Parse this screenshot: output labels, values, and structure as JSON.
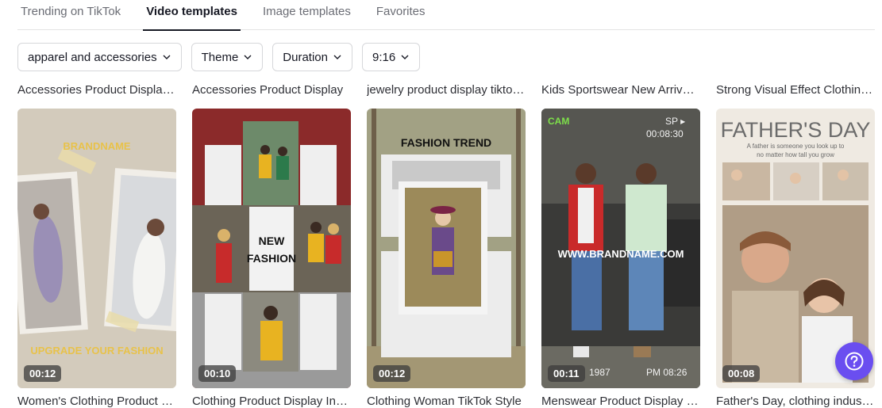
{
  "tabs": [
    {
      "label": "Trending on TikTok",
      "active": false
    },
    {
      "label": "Video templates",
      "active": true
    },
    {
      "label": "Image templates",
      "active": false
    },
    {
      "label": "Favorites",
      "active": false
    }
  ],
  "filters": [
    {
      "label": "apparel and accessories"
    },
    {
      "label": "Theme"
    },
    {
      "label": "Duration"
    },
    {
      "label": "9:16"
    }
  ],
  "cards": [
    {
      "title": "Accessories Product Display ...",
      "caption": "Women's Clothing Product Di...",
      "duration": "00:12",
      "overlay_texts": [
        "BRANDNAME",
        "UPGRADE YOUR FASHION"
      ]
    },
    {
      "title": "Accessories Product Display",
      "caption": "Clothing Product Display In a ...",
      "duration": "00:10",
      "overlay_texts": [
        "NEW",
        "FASHION"
      ]
    },
    {
      "title": "jewelry product display tiktok...",
      "caption": "Clothing Woman TikTok Style",
      "duration": "00:12",
      "overlay_texts": [
        "FASHION TREND"
      ]
    },
    {
      "title": "Kids Sportswear New Arrival ...",
      "caption": "Menswear Product Display B...",
      "duration": "00:11",
      "overlay_texts": [
        "CAM",
        "SP ▸",
        "00:08:30",
        "WWW.BRANDNAME.COM",
        "1987",
        "PM 08:26"
      ]
    },
    {
      "title": "Strong Visual Effect Clothing ...",
      "caption": "Father's Day, clothing industr...",
      "duration": "00:08",
      "overlay_texts": [
        "FATHER'S DAY",
        "A father is someone you look up to",
        "no matter how tall you grow"
      ]
    }
  ],
  "help": {
    "icon": "question-icon"
  },
  "colors": {
    "accent": "#6a4ef0",
    "active_tab": "#161823",
    "inactive_tab": "#6b6d75"
  }
}
